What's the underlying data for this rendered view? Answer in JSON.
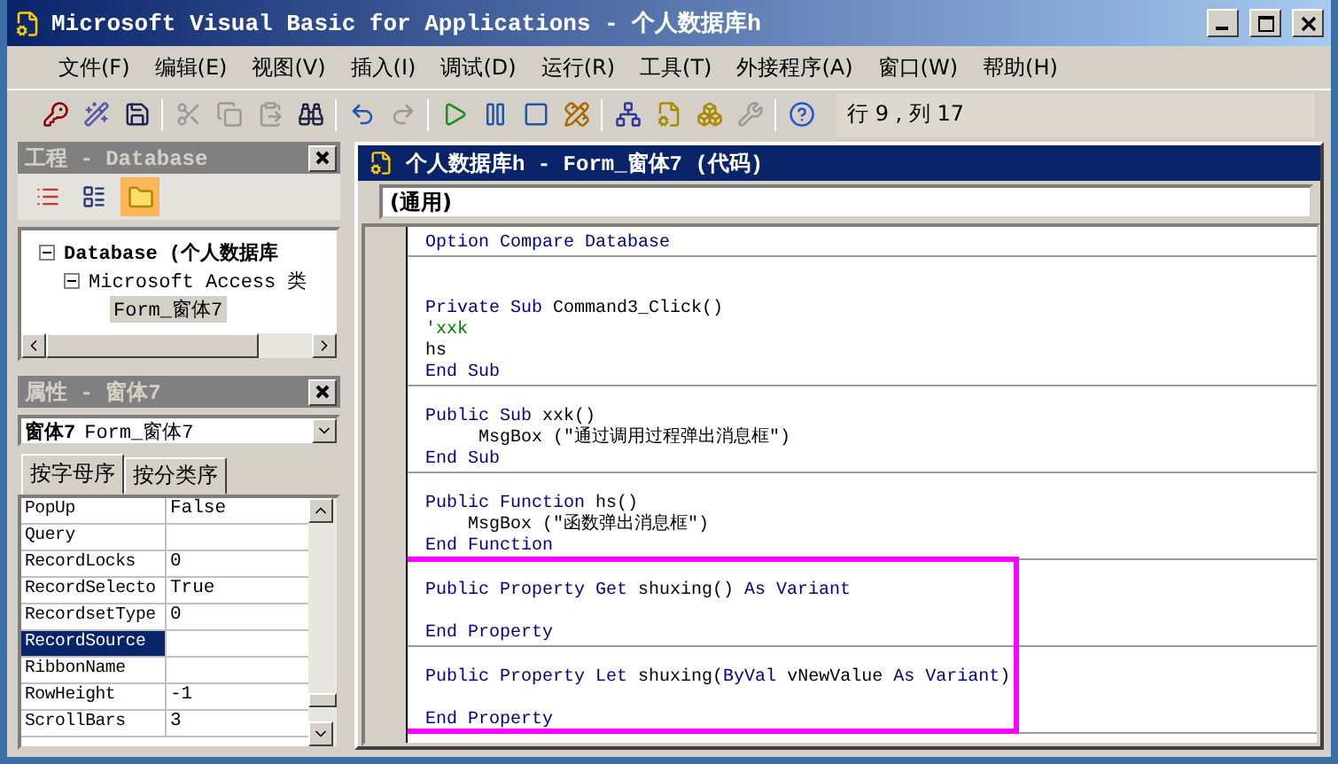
{
  "window": {
    "title": "Microsoft Visual Basic for Applications - 个人数据库h"
  },
  "menu": [
    "文件(F)",
    "编辑(E)",
    "视图(V)",
    "插入(I)",
    "调试(D)",
    "运行(R)",
    "工具(T)",
    "外接程序(A)",
    "窗口(W)",
    "帮助(H)"
  ],
  "toolbar": {
    "position": "行 9 , 列 17"
  },
  "project_pane": {
    "title": "工程 - Database",
    "tree": [
      {
        "label": "Database (个人数据库",
        "bold": true,
        "expanded": true,
        "selected": false,
        "children": [
          {
            "label": "Microsoft Access 类",
            "bold": false,
            "expanded": true,
            "selected": false,
            "children": [
              {
                "label": "Form_窗体7",
                "bold": false,
                "selected": true
              }
            ]
          }
        ]
      }
    ]
  },
  "properties_pane": {
    "title": "属性 - 窗体7",
    "object_type": "窗体7",
    "object_name": "Form_窗体7",
    "tabs": [
      {
        "label": "按字母序",
        "selected": true
      },
      {
        "label": "按分类序",
        "selected": false
      }
    ],
    "rows": [
      {
        "name": "PopUp",
        "value": "False",
        "selected": false
      },
      {
        "name": "Query",
        "selected": false
      },
      {
        "name": "RecordLocks",
        "value": "0",
        "selected": false
      },
      {
        "name": "RecordSelecto",
        "value": "True",
        "selected": false
      },
      {
        "name": "RecordsetType",
        "value": "0",
        "selected": false
      },
      {
        "name": "RecordSource",
        "selected": true
      },
      {
        "name": "RibbonName",
        "selected": false
      },
      {
        "name": "RowHeight",
        "value": "-1",
        "selected": false
      },
      {
        "name": "ScrollBars",
        "value": "3",
        "selected": false
      }
    ]
  },
  "code_window": {
    "title": "个人数据库h - Form_窗体7 (代码)",
    "object_box": "(通用)",
    "procedures": [
      {
        "lines": [
          {
            "kind": "code",
            "tokens": [
              {
                "text": "Option Compare Database",
                "kind": "keyword"
              }
            ]
          }
        ]
      },
      {
        "lines": [
          {
            "kind": "blank"
          },
          {
            "kind": "blank"
          },
          {
            "kind": "code",
            "tokens": [
              {
                "text": "Private Sub",
                "kind": "keyword"
              },
              {
                "text": " Command3_Click()",
                "kind": "plain"
              }
            ]
          },
          {
            "kind": "code",
            "tokens": [
              {
                "text": "'xxk",
                "kind": "comment"
              }
            ]
          },
          {
            "kind": "code",
            "tokens": [
              {
                "text": "hs",
                "kind": "plain"
              }
            ]
          },
          {
            "kind": "code",
            "tokens": [
              {
                "text": "End Sub",
                "kind": "keyword"
              }
            ]
          }
        ]
      },
      {
        "lines": [
          {
            "kind": "blank"
          },
          {
            "kind": "code",
            "tokens": [
              {
                "text": "Public Sub",
                "kind": "keyword"
              },
              {
                "text": " xxk()",
                "kind": "plain"
              }
            ]
          },
          {
            "kind": "code",
            "tokens": [
              {
                "text": "     MsgBox (\"通过调用过程弹出消息框\")",
                "kind": "plain"
              }
            ]
          },
          {
            "kind": "code",
            "tokens": [
              {
                "text": "End Sub",
                "kind": "keyword"
              }
            ]
          }
        ]
      },
      {
        "lines": [
          {
            "kind": "blank"
          },
          {
            "kind": "code",
            "tokens": [
              {
                "text": "Public Function",
                "kind": "keyword"
              },
              {
                "text": " hs()",
                "kind": "plain"
              }
            ]
          },
          {
            "kind": "code",
            "tokens": [
              {
                "text": "    MsgBox (\"函数弹出消息框\")",
                "kind": "plain"
              }
            ]
          },
          {
            "kind": "code",
            "tokens": [
              {
                "text": "End Function",
                "kind": "keyword"
              }
            ]
          }
        ]
      },
      {
        "highlighted": true,
        "lines": [
          {
            "kind": "blank"
          },
          {
            "kind": "code",
            "tokens": [
              {
                "text": "Public Property Get",
                "kind": "keyword"
              },
              {
                "text": " shuxing() ",
                "kind": "plain"
              },
              {
                "text": "As Variant",
                "kind": "keyword"
              }
            ]
          },
          {
            "kind": "blank"
          },
          {
            "kind": "code",
            "tokens": [
              {
                "text": "End Property",
                "kind": "keyword"
              }
            ]
          }
        ]
      },
      {
        "highlighted": true,
        "lines": [
          {
            "kind": "blank"
          },
          {
            "kind": "code",
            "tokens": [
              {
                "text": "Public Property Let",
                "kind": "keyword"
              },
              {
                "text": " shuxing(",
                "kind": "plain"
              },
              {
                "text": "ByVal",
                "kind": "keyword"
              },
              {
                "text": " vNewValue ",
                "kind": "plain"
              },
              {
                "text": "As Variant",
                "kind": "keyword"
              },
              {
                "text": ")",
                "kind": "plain"
              }
            ]
          },
          {
            "kind": "blank"
          },
          {
            "kind": "code",
            "tokens": [
              {
                "text": "End Property",
                "kind": "keyword"
              }
            ]
          }
        ]
      }
    ]
  }
}
